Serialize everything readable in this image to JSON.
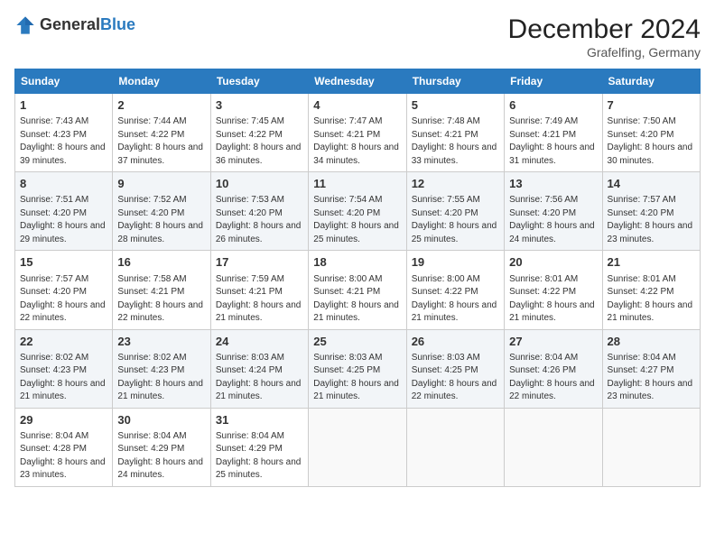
{
  "header": {
    "logo_general": "General",
    "logo_blue": "Blue",
    "month_year": "December 2024",
    "location": "Grafelfing, Germany"
  },
  "weekdays": [
    "Sunday",
    "Monday",
    "Tuesday",
    "Wednesday",
    "Thursday",
    "Friday",
    "Saturday"
  ],
  "weeks": [
    [
      {
        "day": "1",
        "info": "Sunrise: 7:43 AM\nSunset: 4:23 PM\nDaylight: 8 hours and 39 minutes."
      },
      {
        "day": "2",
        "info": "Sunrise: 7:44 AM\nSunset: 4:22 PM\nDaylight: 8 hours and 37 minutes."
      },
      {
        "day": "3",
        "info": "Sunrise: 7:45 AM\nSunset: 4:22 PM\nDaylight: 8 hours and 36 minutes."
      },
      {
        "day": "4",
        "info": "Sunrise: 7:47 AM\nSunset: 4:21 PM\nDaylight: 8 hours and 34 minutes."
      },
      {
        "day": "5",
        "info": "Sunrise: 7:48 AM\nSunset: 4:21 PM\nDaylight: 8 hours and 33 minutes."
      },
      {
        "day": "6",
        "info": "Sunrise: 7:49 AM\nSunset: 4:21 PM\nDaylight: 8 hours and 31 minutes."
      },
      {
        "day": "7",
        "info": "Sunrise: 7:50 AM\nSunset: 4:20 PM\nDaylight: 8 hours and 30 minutes."
      }
    ],
    [
      {
        "day": "8",
        "info": "Sunrise: 7:51 AM\nSunset: 4:20 PM\nDaylight: 8 hours and 29 minutes."
      },
      {
        "day": "9",
        "info": "Sunrise: 7:52 AM\nSunset: 4:20 PM\nDaylight: 8 hours and 28 minutes."
      },
      {
        "day": "10",
        "info": "Sunrise: 7:53 AM\nSunset: 4:20 PM\nDaylight: 8 hours and 26 minutes."
      },
      {
        "day": "11",
        "info": "Sunrise: 7:54 AM\nSunset: 4:20 PM\nDaylight: 8 hours and 25 minutes."
      },
      {
        "day": "12",
        "info": "Sunrise: 7:55 AM\nSunset: 4:20 PM\nDaylight: 8 hours and 25 minutes."
      },
      {
        "day": "13",
        "info": "Sunrise: 7:56 AM\nSunset: 4:20 PM\nDaylight: 8 hours and 24 minutes."
      },
      {
        "day": "14",
        "info": "Sunrise: 7:57 AM\nSunset: 4:20 PM\nDaylight: 8 hours and 23 minutes."
      }
    ],
    [
      {
        "day": "15",
        "info": "Sunrise: 7:57 AM\nSunset: 4:20 PM\nDaylight: 8 hours and 22 minutes."
      },
      {
        "day": "16",
        "info": "Sunrise: 7:58 AM\nSunset: 4:21 PM\nDaylight: 8 hours and 22 minutes."
      },
      {
        "day": "17",
        "info": "Sunrise: 7:59 AM\nSunset: 4:21 PM\nDaylight: 8 hours and 21 minutes."
      },
      {
        "day": "18",
        "info": "Sunrise: 8:00 AM\nSunset: 4:21 PM\nDaylight: 8 hours and 21 minutes."
      },
      {
        "day": "19",
        "info": "Sunrise: 8:00 AM\nSunset: 4:22 PM\nDaylight: 8 hours and 21 minutes."
      },
      {
        "day": "20",
        "info": "Sunrise: 8:01 AM\nSunset: 4:22 PM\nDaylight: 8 hours and 21 minutes."
      },
      {
        "day": "21",
        "info": "Sunrise: 8:01 AM\nSunset: 4:22 PM\nDaylight: 8 hours and 21 minutes."
      }
    ],
    [
      {
        "day": "22",
        "info": "Sunrise: 8:02 AM\nSunset: 4:23 PM\nDaylight: 8 hours and 21 minutes."
      },
      {
        "day": "23",
        "info": "Sunrise: 8:02 AM\nSunset: 4:23 PM\nDaylight: 8 hours and 21 minutes."
      },
      {
        "day": "24",
        "info": "Sunrise: 8:03 AM\nSunset: 4:24 PM\nDaylight: 8 hours and 21 minutes."
      },
      {
        "day": "25",
        "info": "Sunrise: 8:03 AM\nSunset: 4:25 PM\nDaylight: 8 hours and 21 minutes."
      },
      {
        "day": "26",
        "info": "Sunrise: 8:03 AM\nSunset: 4:25 PM\nDaylight: 8 hours and 22 minutes."
      },
      {
        "day": "27",
        "info": "Sunrise: 8:04 AM\nSunset: 4:26 PM\nDaylight: 8 hours and 22 minutes."
      },
      {
        "day": "28",
        "info": "Sunrise: 8:04 AM\nSunset: 4:27 PM\nDaylight: 8 hours and 23 minutes."
      }
    ],
    [
      {
        "day": "29",
        "info": "Sunrise: 8:04 AM\nSunset: 4:28 PM\nDaylight: 8 hours and 23 minutes."
      },
      {
        "day": "30",
        "info": "Sunrise: 8:04 AM\nSunset: 4:29 PM\nDaylight: 8 hours and 24 minutes."
      },
      {
        "day": "31",
        "info": "Sunrise: 8:04 AM\nSunset: 4:29 PM\nDaylight: 8 hours and 25 minutes."
      },
      null,
      null,
      null,
      null
    ]
  ]
}
